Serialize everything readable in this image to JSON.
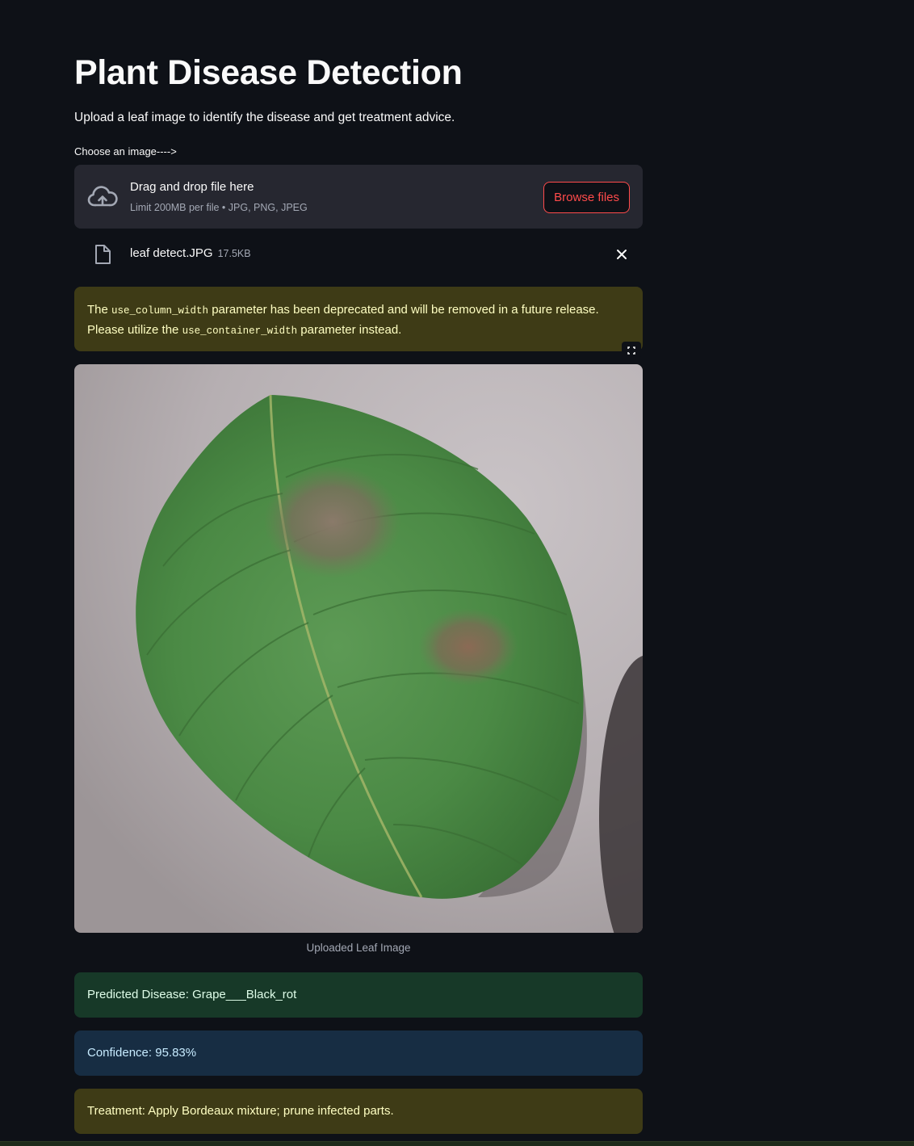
{
  "header": {
    "title": "Plant Disease Detection",
    "subtitle": "Upload a leaf image to identify the disease and get treatment advice."
  },
  "uploader": {
    "label": "Choose an image---->",
    "drop_title": "Drag and drop file here",
    "limit_text": "Limit 200MB per file • JPG, PNG, JPEG",
    "browse_label": "Browse files",
    "icon": "cloud-upload-icon"
  },
  "uploaded_file": {
    "name": "leaf detect.JPG",
    "size": "17.5KB",
    "icon": "file-icon"
  },
  "deprecation_warning": {
    "text_before": "The ",
    "code_old": "use_column_width",
    "text_middle": " parameter has been deprecated and will be removed in a future release. Please utilize the ",
    "code_new": "use_container_width",
    "text_after": " parameter instead."
  },
  "image": {
    "caption": "Uploaded Leaf Image"
  },
  "results": {
    "prediction": "Predicted Disease: Grape___Black_rot",
    "confidence": "Confidence: 95.83%",
    "treatment": "Treatment: Apply Bordeaux mixture; prune infected parts."
  },
  "colors": {
    "background": "#0e1117",
    "accent": "#ff4b4b",
    "success_bg": "#173928",
    "info_bg": "#172d43",
    "warning_bg": "#3e3b16"
  }
}
